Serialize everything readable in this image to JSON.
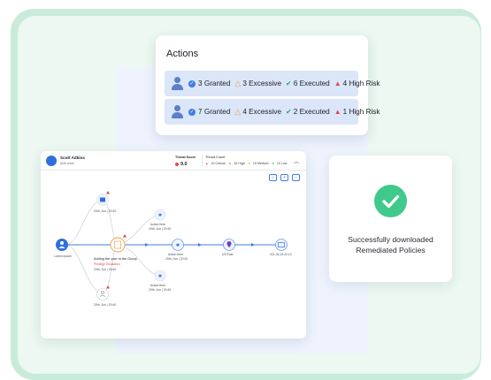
{
  "actions": {
    "title": "Actions",
    "rows": [
      {
        "granted": "3 Granted",
        "excessive": "3 Excessive",
        "executed": "6 Executed",
        "high_risk": "4 High Risk"
      },
      {
        "granted": "7 Granted",
        "excessive": "4 Excessive",
        "executed": "2 Executed",
        "high_risk": "1 High Risk"
      }
    ]
  },
  "success": {
    "line1": "Successfully downloaded",
    "line2": "Remediated Policies"
  },
  "graph": {
    "user_name": "Scott Adkins",
    "user_role": "IAM User",
    "threat_score_label": "Threat Score",
    "threat_score_value": "9.0",
    "threat_breakdown_label": "Threat Count",
    "threat_breakdown": [
      "10 Critical",
      "10 High",
      "10 Medium",
      "10 Low"
    ],
    "nodes": {
      "user": "Lorem Ipsum",
      "group": "Adding the user to the Group",
      "group_badge": "Privilege Escalation",
      "group_time": "20th, Jun | 20:40",
      "policy_top": "20th, Jun | 20:40",
      "action_top": "Action Item",
      "action_top_time": "20th, Jun | 20:40",
      "action_mid": "Action Item",
      "action_mid_time": "20th, Jun | 20:40",
      "action_bottom": "Action Item",
      "action_bottom_time": "20th, Jun | 20:40",
      "location": "US East",
      "instance": "021-34.23.22.10",
      "user_bottom": "20th, Jun | 20:40"
    }
  },
  "colors": {
    "accent": "#3f7de0",
    "success": "#3fc98a",
    "warning": "#f0a04b",
    "danger": "#e04848",
    "executed": "#1fae6a"
  }
}
